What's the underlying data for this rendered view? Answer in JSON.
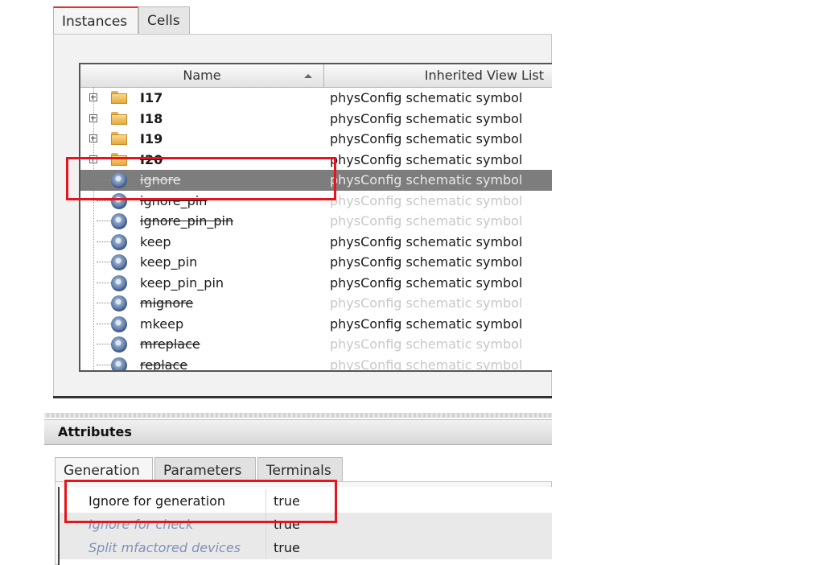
{
  "tabs": [
    "Instances",
    "Cells"
  ],
  "tree": {
    "columns": {
      "name": "Name",
      "view": "Inherited View List"
    },
    "rows": [
      {
        "name": "I17",
        "view": "physConfig schematic symbol",
        "type": "folder",
        "bold": true,
        "strike": false,
        "faded": false,
        "selected": false
      },
      {
        "name": "I18",
        "view": "physConfig schematic symbol",
        "type": "folder",
        "bold": true,
        "strike": false,
        "faded": false,
        "selected": false
      },
      {
        "name": "I19",
        "view": "physConfig schematic symbol",
        "type": "folder",
        "bold": true,
        "strike": false,
        "faded": false,
        "selected": false
      },
      {
        "name": "I20",
        "view": "physConfig schematic symbol",
        "type": "folder",
        "bold": true,
        "strike": true,
        "faded": false,
        "selected": false
      },
      {
        "name": "ignore",
        "view": "physConfig schematic symbol",
        "type": "leaf",
        "bold": false,
        "strike": true,
        "faded": false,
        "selected": true
      },
      {
        "name": "ignore_pin",
        "view": "physConfig schematic symbol",
        "type": "leaf",
        "bold": false,
        "strike": true,
        "faded": true,
        "selected": false
      },
      {
        "name": "ignore_pin_pin",
        "view": "physConfig schematic symbol",
        "type": "leaf",
        "bold": false,
        "strike": true,
        "faded": true,
        "selected": false
      },
      {
        "name": "keep",
        "view": "physConfig schematic symbol",
        "type": "leaf",
        "bold": false,
        "strike": false,
        "faded": false,
        "selected": false
      },
      {
        "name": "keep_pin",
        "view": "physConfig schematic symbol",
        "type": "leaf",
        "bold": false,
        "strike": false,
        "faded": false,
        "selected": false
      },
      {
        "name": "keep_pin_pin",
        "view": "physConfig schematic symbol",
        "type": "leaf",
        "bold": false,
        "strike": false,
        "faded": false,
        "selected": false
      },
      {
        "name": "mignore",
        "view": "physConfig schematic symbol",
        "type": "leaf",
        "bold": false,
        "strike": true,
        "faded": true,
        "selected": false
      },
      {
        "name": "mkeep",
        "view": "physConfig schematic symbol",
        "type": "leaf",
        "bold": false,
        "strike": false,
        "faded": false,
        "selected": false
      },
      {
        "name": "mreplace",
        "view": "physConfig schematic symbol",
        "type": "leaf",
        "bold": false,
        "strike": true,
        "faded": true,
        "selected": false
      },
      {
        "name": "replace",
        "view": "physConfig schematic symbol",
        "type": "leaf",
        "bold": false,
        "strike": true,
        "faded": true,
        "selected": false
      }
    ]
  },
  "attributes": {
    "title": "Attributes",
    "tabs": [
      "Generation",
      "Parameters",
      "Terminals"
    ],
    "rows": [
      {
        "key": "Ignore for generation",
        "value": "true",
        "dim": false
      },
      {
        "key": "Ignore for check",
        "value": "true",
        "dim": true
      },
      {
        "key": "Split mfactored devices",
        "value": "true",
        "dim": true
      }
    ]
  },
  "colors": {
    "highlight": "#e8141c",
    "selection": "#7d7d7d"
  }
}
